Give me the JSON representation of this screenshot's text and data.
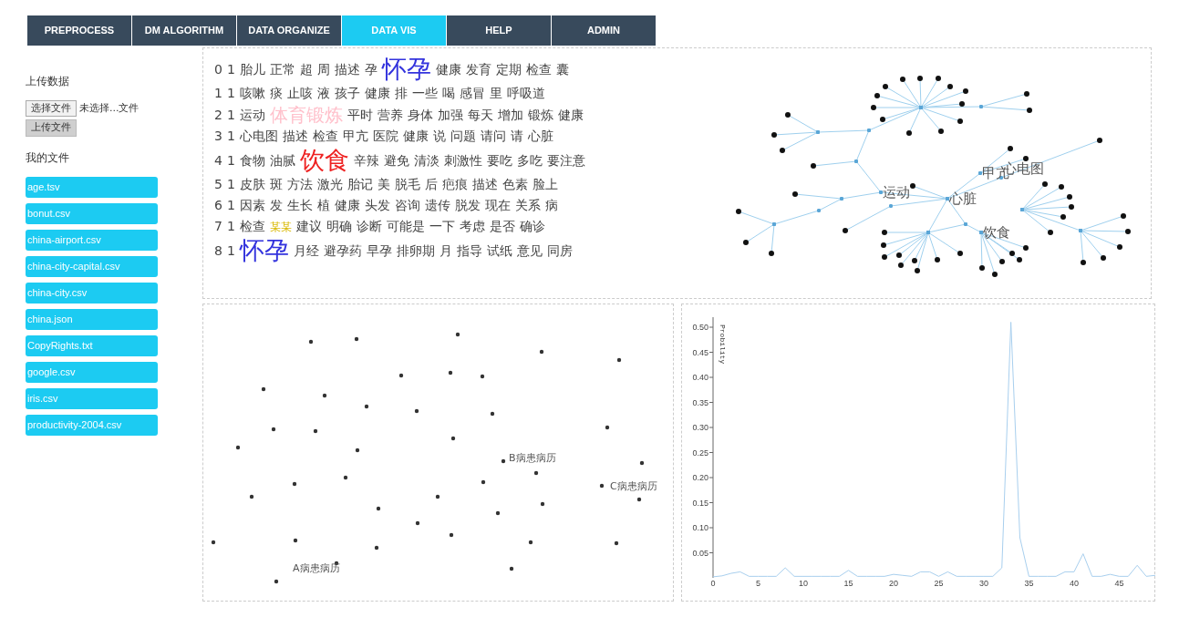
{
  "nav": [
    {
      "label": "PREPROCESS",
      "selected": false
    },
    {
      "label": "DM ALGORITHM",
      "selected": false
    },
    {
      "label": "DATA ORGANIZE",
      "selected": false
    },
    {
      "label": "DATA VIS",
      "selected": true
    },
    {
      "label": "HELP",
      "selected": false
    },
    {
      "label": "ADMIN",
      "selected": false
    }
  ],
  "sidebar": {
    "upload_title": "上传数据",
    "choose_button": "选择文件",
    "file_status": "未选择...文件",
    "upload_button": "上传文件",
    "files_title": "我的文件",
    "files": [
      "age.tsv",
      "bonut.csv",
      "china-airport.csv",
      "china-city-capital.csv",
      "china-city.csv",
      "china.json",
      "CopyRights.txt",
      "google.csv",
      "iris.csv",
      "productivity-2004.csv"
    ]
  },
  "topics": [
    {
      "id": "0",
      "count": "1",
      "words": [
        {
          "text": "胎儿"
        },
        {
          "text": "正常"
        },
        {
          "text": "超"
        },
        {
          "text": "周"
        },
        {
          "text": "描述"
        },
        {
          "text": "孕"
        },
        {
          "text": "怀孕",
          "kind": "large",
          "color": "#3333dd"
        },
        {
          "text": "健康"
        },
        {
          "text": "发育"
        },
        {
          "text": "定期"
        },
        {
          "text": "检查"
        },
        {
          "text": "囊"
        }
      ]
    },
    {
      "id": "1",
      "count": "1",
      "words": [
        {
          "text": "咳嗽"
        },
        {
          "text": "痰"
        },
        {
          "text": "止咳"
        },
        {
          "text": "液"
        },
        {
          "text": "孩子"
        },
        {
          "text": "健康"
        },
        {
          "text": "排"
        },
        {
          "text": "一些"
        },
        {
          "text": "喝"
        },
        {
          "text": "感冒"
        },
        {
          "text": "里"
        },
        {
          "text": "呼吸道"
        }
      ]
    },
    {
      "id": "2",
      "count": "1",
      "words": [
        {
          "text": "运动"
        },
        {
          "text": "体育锻炼",
          "kind": "medium",
          "color": "#ffc0cb"
        },
        {
          "text": "平时"
        },
        {
          "text": "营养"
        },
        {
          "text": "身体"
        },
        {
          "text": "加强"
        },
        {
          "text": "每天"
        },
        {
          "text": "增加"
        },
        {
          "text": "锻炼"
        },
        {
          "text": "健康"
        }
      ]
    },
    {
      "id": "3",
      "count": "1",
      "words": [
        {
          "text": "心电图"
        },
        {
          "text": "描述"
        },
        {
          "text": "检查"
        },
        {
          "text": "甲亢"
        },
        {
          "text": "医院"
        },
        {
          "text": "健康"
        },
        {
          "text": "说"
        },
        {
          "text": "问题"
        },
        {
          "text": "请问"
        },
        {
          "text": "请"
        },
        {
          "text": "心脏"
        }
      ]
    },
    {
      "id": "4",
      "count": "1",
      "words": [
        {
          "text": "食物"
        },
        {
          "text": "油腻"
        },
        {
          "text": "饮食",
          "kind": "large",
          "color": "#ee2222"
        },
        {
          "text": "辛辣"
        },
        {
          "text": "避免"
        },
        {
          "text": "清淡"
        },
        {
          "text": "刺激性"
        },
        {
          "text": "要吃"
        },
        {
          "text": "多吃"
        },
        {
          "text": "要注意"
        }
      ]
    },
    {
      "id": "5",
      "count": "1",
      "words": [
        {
          "text": "皮肤"
        },
        {
          "text": "斑"
        },
        {
          "text": "方法"
        },
        {
          "text": "激光"
        },
        {
          "text": "胎记"
        },
        {
          "text": "美"
        },
        {
          "text": "脱毛"
        },
        {
          "text": "后"
        },
        {
          "text": "疤痕"
        },
        {
          "text": "描述"
        },
        {
          "text": "色素"
        },
        {
          "text": "脸上"
        }
      ]
    },
    {
      "id": "6",
      "count": "1",
      "words": [
        {
          "text": "因素"
        },
        {
          "text": "发"
        },
        {
          "text": "生长"
        },
        {
          "text": "植"
        },
        {
          "text": "健康"
        },
        {
          "text": "头发"
        },
        {
          "text": "咨询"
        },
        {
          "text": "遗传"
        },
        {
          "text": "脱发"
        },
        {
          "text": "现在"
        },
        {
          "text": "关系"
        },
        {
          "text": "病"
        }
      ]
    },
    {
      "id": "7",
      "count": "1",
      "words": [
        {
          "text": "检查"
        },
        {
          "text": "某某",
          "kind": "small",
          "color": "#d9b800"
        },
        {
          "text": "建议"
        },
        {
          "text": "明确"
        },
        {
          "text": "诊断"
        },
        {
          "text": "可能是"
        },
        {
          "text": "一下"
        },
        {
          "text": "考虑"
        },
        {
          "text": "是否"
        },
        {
          "text": "确诊"
        }
      ]
    },
    {
      "id": "8",
      "count": "1",
      "words": [
        {
          "text": "怀孕",
          "kind": "large",
          "color": "#3333dd"
        },
        {
          "text": "月经"
        },
        {
          "text": "避孕药"
        },
        {
          "text": "早孕"
        },
        {
          "text": "排卵期"
        },
        {
          "text": "月"
        },
        {
          "text": "指导"
        },
        {
          "text": "试纸"
        },
        {
          "text": "意见"
        },
        {
          "text": "同房"
        }
      ]
    }
  ],
  "network": {
    "labels": [
      "运动",
      "心脏",
      "甲亢",
      "心电图",
      "饮食"
    ]
  },
  "scatter": {
    "labels": [
      "B病患病历",
      "C病患病历",
      "A病患病历"
    ]
  },
  "line_chart": {
    "chart_data": {
      "type": "line",
      "ylabel": "Probility",
      "xlim": [
        0,
        49
      ],
      "ylim": [
        0,
        0.52
      ],
      "xticks": [
        0,
        5,
        10,
        15,
        20,
        25,
        30,
        35,
        40,
        45
      ],
      "yticks": [
        {
          "value": 0.05,
          "label": "0.05"
        },
        {
          "value": 0.1,
          "label": "0.10"
        },
        {
          "value": 0.15,
          "label": "0.15"
        },
        {
          "value": 0.2,
          "label": "0.20"
        },
        {
          "value": 0.25,
          "label": "0.25"
        },
        {
          "value": 0.3,
          "label": "0.30"
        },
        {
          "value": 0.35,
          "label": "0.35"
        },
        {
          "value": 0.4,
          "label": "0.40"
        },
        {
          "value": 0.45,
          "label": "0.45"
        },
        {
          "value": 0.5,
          "label": "0.50"
        }
      ],
      "x": [
        0,
        1,
        2,
        3,
        4,
        5,
        6,
        7,
        8,
        9,
        10,
        11,
        12,
        13,
        14,
        15,
        16,
        17,
        18,
        19,
        20,
        21,
        22,
        23,
        24,
        25,
        26,
        27,
        28,
        29,
        30,
        31,
        32,
        33,
        34,
        35,
        36,
        37,
        38,
        39,
        40,
        41,
        42,
        43,
        44,
        45,
        46,
        47,
        48,
        49
      ],
      "series": [
        {
          "color": "#a8cfee",
          "values": [
            0.002,
            0.004,
            0.009,
            0.012,
            0.003,
            0.003,
            0.003,
            0.003,
            0.02,
            0.003,
            0.003,
            0.003,
            0.003,
            0.003,
            0.003,
            0.015,
            0.003,
            0.003,
            0.003,
            0.003,
            0.007,
            0.005,
            0.003,
            0.012,
            0.012,
            0.003,
            0.012,
            0.003,
            0.003,
            0.003,
            0.003,
            0.003,
            0.02,
            0.51,
            0.08,
            0.003,
            0.003,
            0.003,
            0.003,
            0.012,
            0.012,
            0.048,
            0.003,
            0.003,
            0.007,
            0.003,
            0.003,
            0.025,
            0.003,
            0.005
          ]
        }
      ]
    }
  }
}
